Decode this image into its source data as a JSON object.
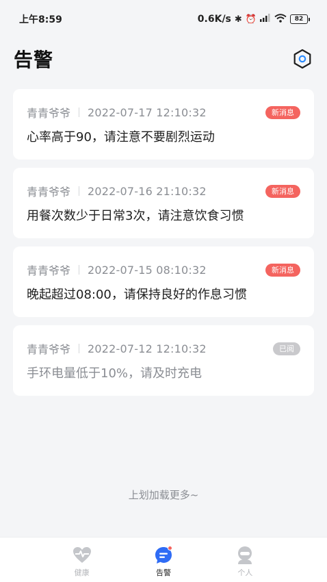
{
  "status_bar": {
    "time": "上午8:59",
    "network_speed": "0.6K/s",
    "battery": "82"
  },
  "header": {
    "title": "告警"
  },
  "alerts": [
    {
      "name": "青青爷爷",
      "time": "2022-07-17 12:10:32",
      "badge": "新消息",
      "message": "心率高于90，请注意不要剧烈运动",
      "read": false
    },
    {
      "name": "青青爷爷",
      "time": "2022-07-16 21:10:32",
      "badge": "新消息",
      "message": "用餐次数少于日常3次，请注意饮食习惯",
      "read": false
    },
    {
      "name": "青青爷爷",
      "time": "2022-07-15 08:10:32",
      "badge": "新消息",
      "message": "晚起超过08:00，请保持良好的作息习惯",
      "read": false
    },
    {
      "name": "青青爷爷",
      "time": "2022-07-12 12:10:32",
      "badge": "已阅",
      "message": "手环电量低于10%，请及时充电",
      "read": true
    }
  ],
  "load_more": "上划加载更多~",
  "tabbar": {
    "tabs": [
      {
        "label": "健康",
        "icon": "heart-pulse-icon",
        "active": false
      },
      {
        "label": "告警",
        "icon": "message-icon",
        "active": true
      },
      {
        "label": "个人",
        "icon": "person-icon",
        "active": false
      }
    ]
  },
  "colors": {
    "accent": "#3b7bf6",
    "badge_new": "#f4645f",
    "badge_read": "#c9c9cc",
    "background": "#f4f5f7"
  }
}
